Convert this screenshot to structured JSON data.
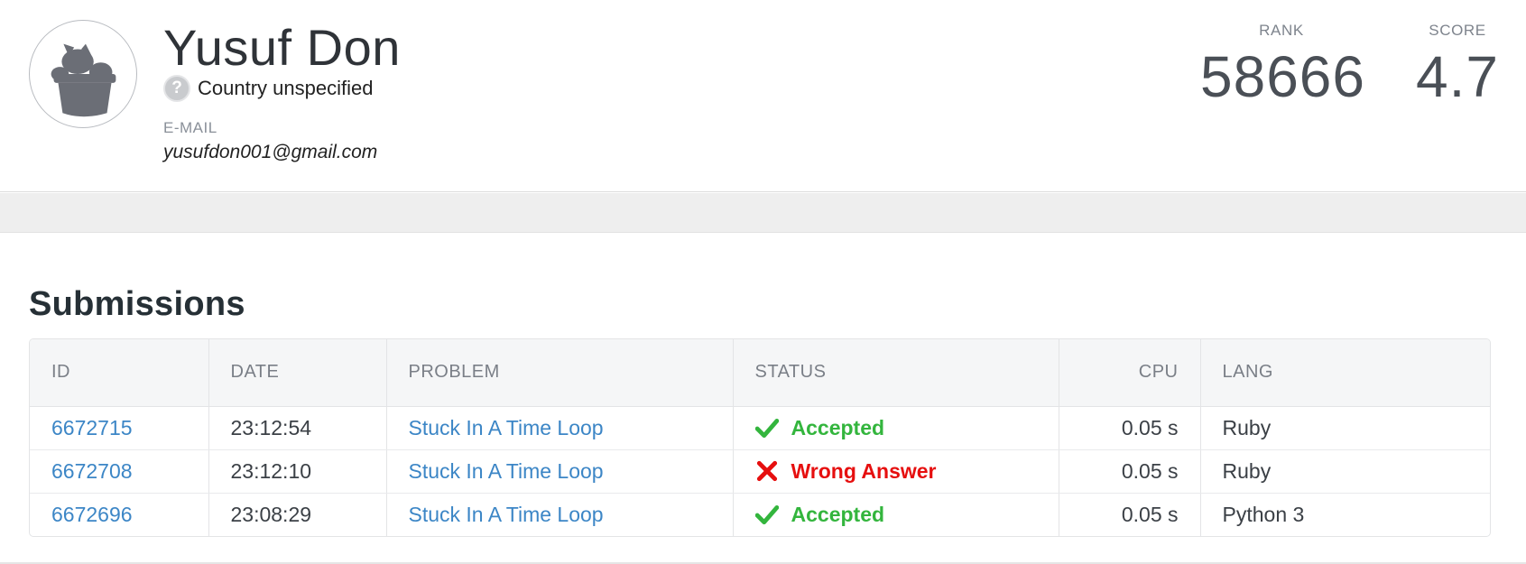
{
  "profile": {
    "name": "Yusuf Don",
    "country": "Country unspecified",
    "email_label": "E-MAIL",
    "email": "yusufdon001@gmail.com"
  },
  "stats": {
    "rank_label": "RANK",
    "rank_value": "58666",
    "score_label": "SCORE",
    "score_value": "4.7"
  },
  "submissions": {
    "title": "Submissions",
    "columns": [
      "ID",
      "DATE",
      "PROBLEM",
      "STATUS",
      "CPU",
      "LANG"
    ],
    "rows": [
      {
        "id": "6672715",
        "date": "23:12:54",
        "problem": "Stuck In A Time Loop",
        "status": "Accepted",
        "status_icon": "check-icon",
        "cpu": "0.05 s",
        "lang": "Ruby"
      },
      {
        "id": "6672708",
        "date": "23:12:10",
        "problem": "Stuck In A Time Loop",
        "status": "Wrong Answer",
        "status_icon": "cross-icon",
        "cpu": "0.05 s",
        "lang": "Ruby"
      },
      {
        "id": "6672696",
        "date": "23:08:29",
        "problem": "Stuck In A Time Loop",
        "status": "Accepted",
        "status_icon": "check-icon",
        "cpu": "0.05 s",
        "lang": "Python 3"
      }
    ]
  },
  "colors": {
    "link": "#3c86c6",
    "accepted": "#33b53d",
    "wrong_answer": "#e60f0f"
  }
}
